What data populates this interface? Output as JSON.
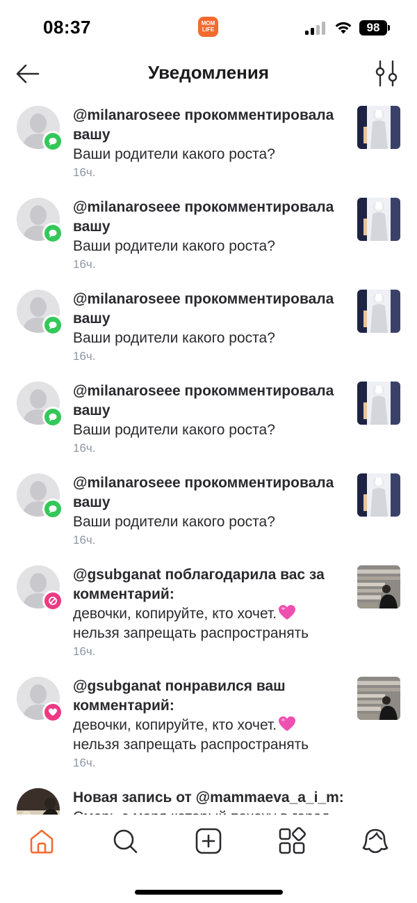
{
  "status_bar": {
    "time": "08:37",
    "app_badge": "MOM LIFE",
    "battery": "98"
  },
  "header": {
    "title": "Уведомления"
  },
  "notifications": [
    {
      "title": "@milanaroseee прокомментировала вашу",
      "body": "Ваши родители какого роста?",
      "time": "16ч.",
      "badge": "comment-icon",
      "badge_color": "#34c759"
    },
    {
      "title": "@milanaroseee прокомментировала вашу",
      "body": "Ваши родители какого роста?",
      "time": "16ч.",
      "badge": "comment-icon",
      "badge_color": "#34c759"
    },
    {
      "title": "@milanaroseee прокомментировала вашу",
      "body": "Ваши родители какого роста?",
      "time": "16ч.",
      "badge": "comment-icon",
      "badge_color": "#34c759"
    },
    {
      "title": "@milanaroseee прокомментировала вашу",
      "body": "Ваши родители какого роста?",
      "time": "16ч.",
      "badge": "comment-icon",
      "badge_color": "#34c759"
    },
    {
      "title": "@milanaroseee прокомментировала вашу",
      "body": "Ваши родители какого роста?",
      "time": "16ч.",
      "badge": "comment-icon",
      "badge_color": "#34c759"
    },
    {
      "title": "@gsubganat поблагодарила вас за комментарий:",
      "body": "девочки, копируйте, кто хочет.",
      "body2": "нельзя запрещать распространять",
      "time": "16ч.",
      "badge": "thanks-icon",
      "badge_color": "#ec3a84"
    },
    {
      "title": "@gsubganat понравился ваш комментарий:",
      "body": "девочки, копируйте, кто хочет.",
      "body2": "нельзя запрещать распространять",
      "time": "16ч.",
      "badge": "heart-icon",
      "badge_color": "#ec3a84"
    },
    {
      "title": "Новая запись от @mammaeva_a_i_m:",
      "body": "Смерь с моря который похоху в город"
    }
  ],
  "bottom_nav": [
    "home-icon",
    "search-icon",
    "add-post-icon",
    "apps-icon",
    "profile-icon"
  ],
  "colors": {
    "accent": "#f46a2e",
    "comment_badge": "#34c759",
    "like_badge": "#ec3a84",
    "time_text": "#8e96a4"
  }
}
